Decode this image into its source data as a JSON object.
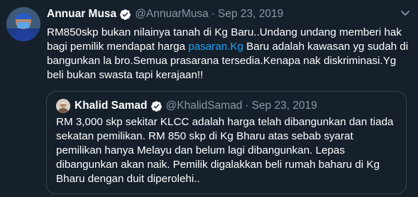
{
  "tweet": {
    "author_name": "Annuar Musa",
    "handle": "@AnnuarMusa",
    "separator": "·",
    "date": "Sep 23, 2019",
    "text_part1": "RM850skp bukan nilainya tanah di Kg Baru..Undang undang memberi hak bagi pemilik mendapat harga ",
    "link_text": "pasaran.Kg",
    "text_part2": " Baru adalah kawasan yg sudah di bangunkan la bro.Semua prasarana tersedia.Kenapa nak diskriminasi.Yg beli bukan swasta tapi kerajaan!!"
  },
  "quoted_tweet": {
    "author_name": "Khalid Samad",
    "handle": "@KhalidSamad",
    "separator": "·",
    "date": "Sep 23, 2019",
    "text": "RM 3,000 skp sekitar KLCC adalah harga telah dibangunkan dan tiada sekatan pemilikan. RM 850 skp di Kg Bharu atas sebab syarat pemilikan hanya Melayu dan belum lagi dibangunkan. Lepas dibangunkan akan naik. Pemilik digalakkan beli rumah baharu di Kg Bharu dengan duit diperolehi.."
  },
  "icons": {
    "verified": "verified-badge-icon",
    "caret": "chevron-down-icon"
  },
  "colors": {
    "background": "#15202b",
    "link": "#1da1f2",
    "secondary_text": "#8899a6",
    "border": "#38444d"
  }
}
